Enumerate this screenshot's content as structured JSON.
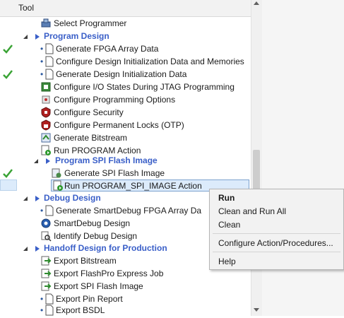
{
  "header": {
    "title": "Tool"
  },
  "rows": [
    {
      "label": "Select Programmer",
      "check": false,
      "type": "item",
      "icon": "programmer-icon"
    },
    {
      "label": "Program Design",
      "check": false,
      "type": "group",
      "icon": ""
    },
    {
      "label": "Generate FPGA Array Data",
      "check": true,
      "type": "item",
      "icon": "document-icon"
    },
    {
      "label": "Configure Design Initialization Data and Memories",
      "check": false,
      "type": "item",
      "icon": "document-icon"
    },
    {
      "label": "Generate Design Initialization Data",
      "check": true,
      "type": "item",
      "icon": "document-icon"
    },
    {
      "label": "Configure I/O States During JTAG Programming",
      "check": false,
      "type": "item",
      "icon": "io-states-icon"
    },
    {
      "label": "Configure Programming Options",
      "check": false,
      "type": "item",
      "icon": "options-icon"
    },
    {
      "label": "Configure Security",
      "check": false,
      "type": "item",
      "icon": "security-icon"
    },
    {
      "label": "Configure Permanent Locks (OTP)",
      "check": false,
      "type": "item",
      "icon": "lock-icon"
    },
    {
      "label": "Generate Bitstream",
      "check": false,
      "type": "item",
      "icon": "bitstream-icon"
    },
    {
      "label": "Run PROGRAM Action",
      "check": false,
      "type": "item",
      "icon": "run-action-icon"
    },
    {
      "label": "Program SPI Flash Image",
      "check": false,
      "type": "group",
      "icon": ""
    },
    {
      "label": "Generate SPI Flash Image",
      "check": true,
      "type": "item",
      "icon": "spi-image-icon"
    },
    {
      "label": "Run PROGRAM_SPI_IMAGE Action",
      "check": false,
      "type": "item",
      "icon": "run-action-icon"
    },
    {
      "label": "Debug Design",
      "check": false,
      "type": "group",
      "icon": ""
    },
    {
      "label": "Generate SmartDebug FPGA Array Da",
      "check": false,
      "type": "item",
      "icon": "document-icon"
    },
    {
      "label": "SmartDebug Design",
      "check": false,
      "type": "item",
      "icon": "smartdebug-icon"
    },
    {
      "label": "Identify Debug Design",
      "check": false,
      "type": "item",
      "icon": "identify-icon"
    },
    {
      "label": "Handoff Design for Production",
      "check": false,
      "type": "group",
      "icon": ""
    },
    {
      "label": "Export Bitstream",
      "check": false,
      "type": "item",
      "icon": "export-icon"
    },
    {
      "label": "Export FlashPro Express Job",
      "check": false,
      "type": "item",
      "icon": "export-icon"
    },
    {
      "label": "Export SPI Flash Image",
      "check": false,
      "type": "item",
      "icon": "export-icon"
    },
    {
      "label": "Export Pin Report",
      "check": false,
      "type": "item",
      "icon": "document-icon"
    },
    {
      "label": "Export BSDL",
      "check": false,
      "type": "item",
      "icon": "document-icon"
    }
  ],
  "context_menu": {
    "items": [
      "Run",
      "Clean and Run All",
      "Clean",
      "Configure Action/Procedures...",
      "Help"
    ]
  },
  "colors": {
    "group_text": "#3a5fc8",
    "check": "#3aa335",
    "selection": "#dcebfb"
  }
}
